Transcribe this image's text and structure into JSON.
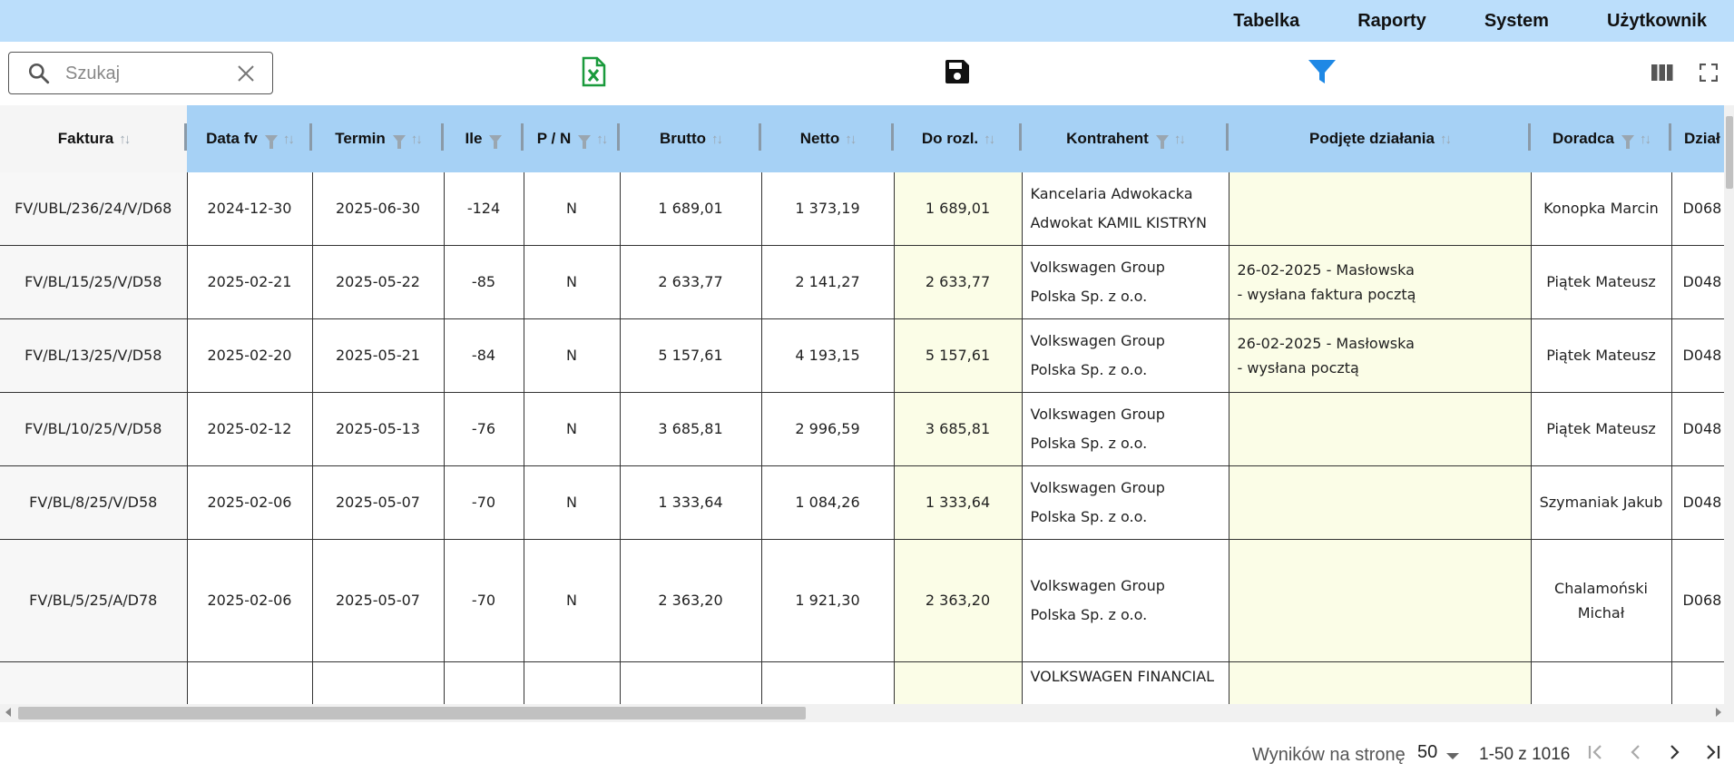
{
  "nav": [
    "Tabelka",
    "Raporty",
    "System",
    "Użytkownik"
  ],
  "search": {
    "placeholder": "Szukaj",
    "value": ""
  },
  "toolbar": {
    "export_icon": "excel-icon",
    "save_icon": "save-icon",
    "filter_icon": "filter-icon",
    "filter_color": "#1e88e5",
    "excel_color": "#1a9a3c"
  },
  "columns": [
    {
      "label": "Faktura",
      "filter": false
    },
    {
      "label": "Data fv",
      "filter": true
    },
    {
      "label": "Termin",
      "filter": true
    },
    {
      "label": "Ile",
      "filter": true
    },
    {
      "label": "P / N",
      "filter": true
    },
    {
      "label": "Brutto",
      "filter": false
    },
    {
      "label": "Netto",
      "filter": false
    },
    {
      "label": "Do rozl.",
      "filter": false
    },
    {
      "label": "Kontrahent",
      "filter": true
    },
    {
      "label": "Podjęte działania",
      "filter": false
    },
    {
      "label": "Doradca",
      "filter": true
    },
    {
      "label": "Dział",
      "filter": false
    }
  ],
  "rows": [
    {
      "faktura": "FV/UBL/236/24/V/D68",
      "data_fv": "2024-12-30",
      "termin": "2025-06-30",
      "ile": "-124",
      "pn": "N",
      "brutto": "1 689,01",
      "netto": "1 373,19",
      "do_rozl": "1 689,01",
      "kontrahent": "Kancelaria Adwokacka\nAdwokat KAMIL KISTRYN",
      "dzialania": "",
      "doradca": "Konopka Marcin",
      "dzial": "D068"
    },
    {
      "faktura": "FV/BL/15/25/V/D58",
      "data_fv": "2025-02-21",
      "termin": "2025-05-22",
      "ile": "-85",
      "pn": "N",
      "brutto": "2 633,77",
      "netto": "2 141,27",
      "do_rozl": "2 633,77",
      "kontrahent": "Volkswagen Group\nPolska Sp. z o.o.",
      "dzialania": "26-02-2025 - Masłowska\n- wysłana faktura pocztą",
      "doradca": "Piątek Mateusz",
      "dzial": "D048"
    },
    {
      "faktura": "FV/BL/13/25/V/D58",
      "data_fv": "2025-02-20",
      "termin": "2025-05-21",
      "ile": "-84",
      "pn": "N",
      "brutto": "5 157,61",
      "netto": "4 193,15",
      "do_rozl": "5 157,61",
      "kontrahent": "Volkswagen Group\nPolska Sp. z o.o.",
      "dzialania": "26-02-2025 - Masłowska\n- wysłana pocztą",
      "doradca": "Piątek Mateusz",
      "dzial": "D048"
    },
    {
      "faktura": "FV/BL/10/25/V/D58",
      "data_fv": "2025-02-12",
      "termin": "2025-05-13",
      "ile": "-76",
      "pn": "N",
      "brutto": "3 685,81",
      "netto": "2 996,59",
      "do_rozl": "3 685,81",
      "kontrahent": "Volkswagen Group\nPolska Sp. z o.o.",
      "dzialania": "",
      "doradca": "Piątek Mateusz",
      "dzial": "D048"
    },
    {
      "faktura": "FV/BL/8/25/V/D58",
      "data_fv": "2025-02-06",
      "termin": "2025-05-07",
      "ile": "-70",
      "pn": "N",
      "brutto": "1 333,64",
      "netto": "1 084,26",
      "do_rozl": "1 333,64",
      "kontrahent": "Volkswagen Group\nPolska Sp. z o.o.",
      "dzialania": "",
      "doradca": "Szymaniak Jakub",
      "dzial": "D048"
    },
    {
      "faktura": "FV/BL/5/25/A/D78",
      "data_fv": "2025-02-06",
      "termin": "2025-05-07",
      "ile": "-70",
      "pn": "N",
      "brutto": "2 363,20",
      "netto": "1 921,30",
      "do_rozl": "2 363,20",
      "kontrahent": "Volkswagen Group\nPolska Sp. z o.o.",
      "dzialania": "",
      "doradca": "Chalamoński\nMichał",
      "dzial": "D068"
    },
    {
      "faktura": "",
      "data_fv": "",
      "termin": "",
      "ile": "",
      "pn": "",
      "brutto": "",
      "netto": "",
      "do_rozl": "",
      "kontrahent": "VOLKSWAGEN FINANCIAL",
      "dzialania": "",
      "doradca": "",
      "dzial": ""
    }
  ],
  "pagination": {
    "label": "Wyników na stronę",
    "page_size": "50",
    "range": "1-50 z 1016"
  },
  "colors": {
    "topbar": "#bbdefb",
    "header": "#a6d1f5",
    "highlight": "#fbfde7"
  }
}
